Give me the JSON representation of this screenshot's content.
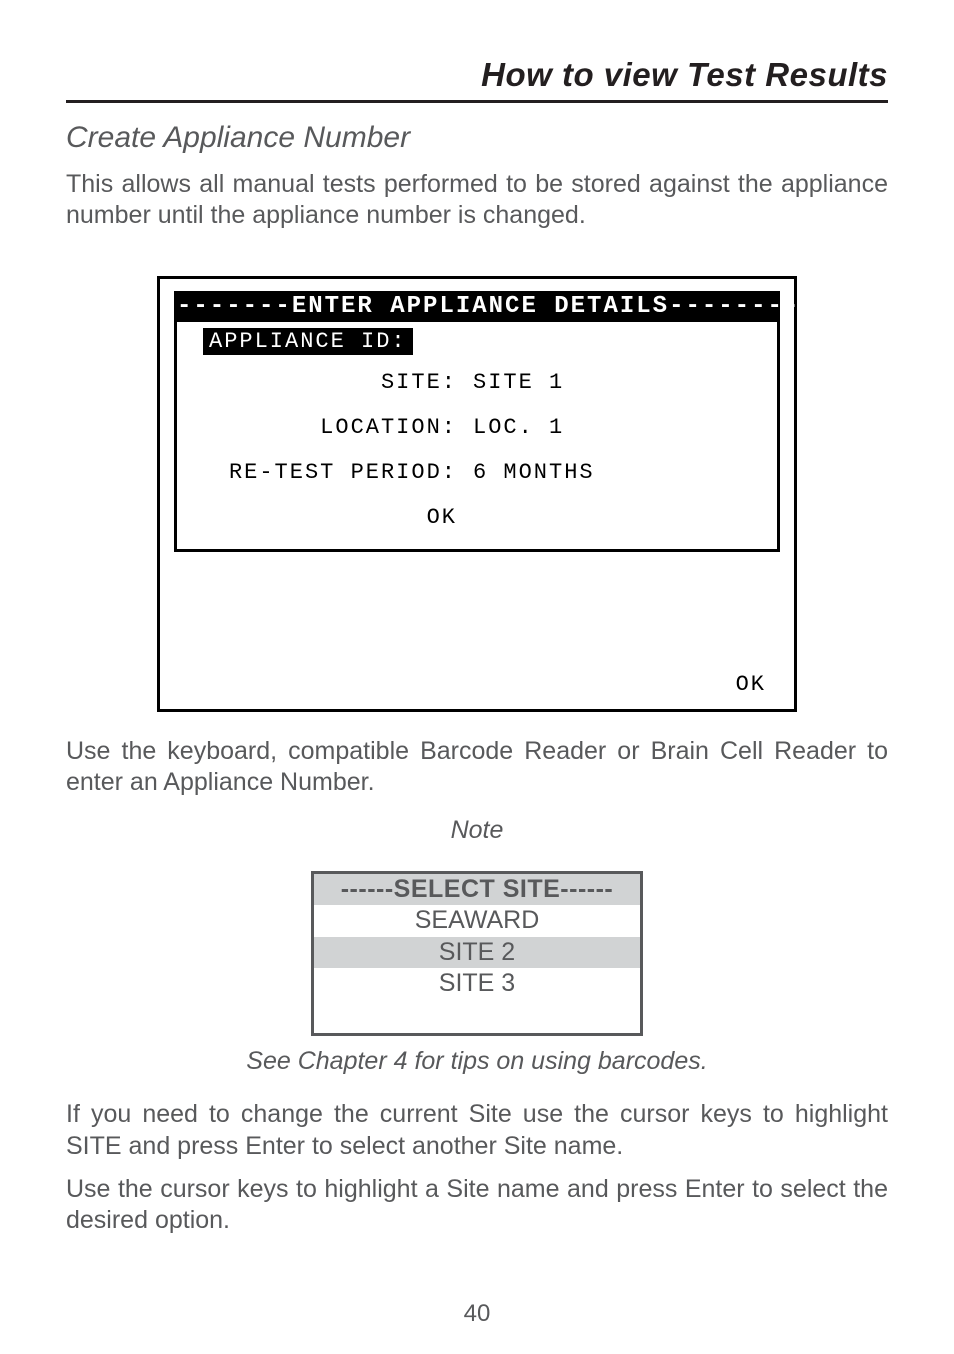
{
  "header": {
    "title": "How to view Test Results"
  },
  "section": {
    "heading": "Create Appliance Number",
    "intro": "This allows all manual tests performed to be stored against the appliance number until the appliance number is changed."
  },
  "device": {
    "title_bar": "-------ENTER APPLIANCE DETAILS--------",
    "appliance_id_chip": "APPLIANCE ID:",
    "rows": {
      "site_label": "SITE:",
      "site_value": "SITE 1",
      "location_label": "LOCATION:",
      "location_value": "LOC. 1",
      "retest_label": "RE-TEST PERIOD:",
      "retest_value": "6 MONTHS",
      "ok_inner": "OK"
    },
    "ok_outer": "OK"
  },
  "after_device": {
    "para": "Use the keyboard, compatible Barcode Reader or Brain Cell Reader to enter an Appliance Number.",
    "note": "Note"
  },
  "select_box": {
    "header": "------SELECT SITE------",
    "rows": [
      "SEAWARD",
      "SITE 2",
      "SITE 3"
    ]
  },
  "after_select": {
    "caption": "See Chapter 4 for tips on using barcodes.",
    "para1": "If you need to change the current Site use the cursor keys to highlight SITE and press Enter to select another Site name.",
    "para2": "Use the cursor keys to highlight a Site name and press Enter to select the desired option."
  },
  "page_number": "40"
}
